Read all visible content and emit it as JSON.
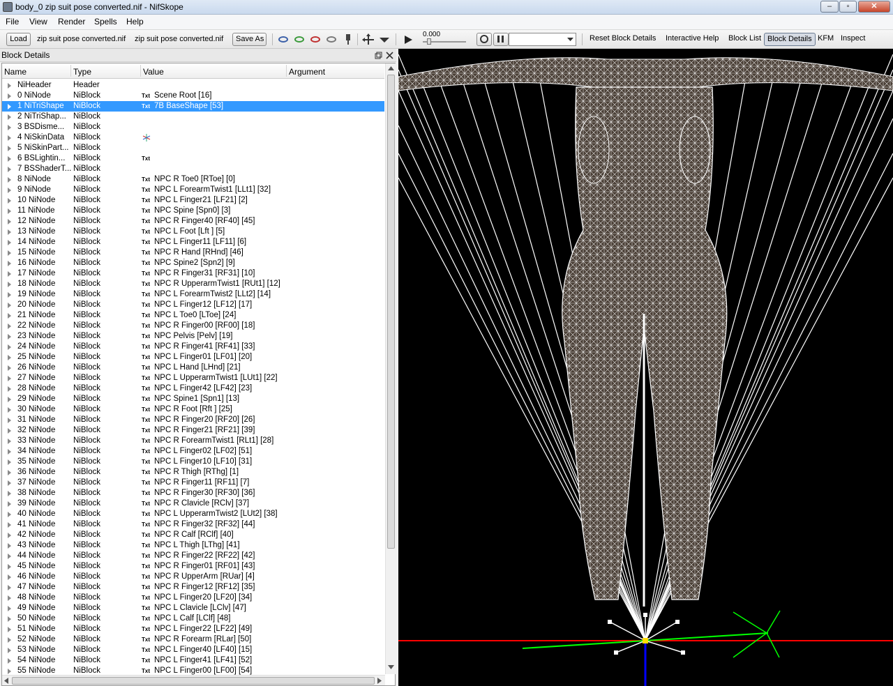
{
  "window": {
    "title": "body_0 zip suit pose converted.nif - NifSkope",
    "controls": [
      "‒",
      "▫",
      "✕"
    ]
  },
  "menu": [
    "File",
    "View",
    "Render",
    "Spells",
    "Help"
  ],
  "toolbar": {
    "load_label": "Load",
    "load_file": "zip suit pose converted.nif",
    "save_file": "zip suit pose converted.nif",
    "save_as_label": "Save As",
    "time_value": "0.000",
    "links": [
      "Reset Block Details",
      "Interactive Help",
      "Block List",
      "Block Details",
      "KFM",
      "Inspect"
    ],
    "active_link": "Block Details"
  },
  "dock": {
    "title": "Block Details",
    "columns": [
      "Name",
      "Type",
      "Value",
      "Argument"
    ]
  },
  "rows": [
    {
      "name": "NiHeader",
      "type": "Header",
      "txt": "",
      "value": ""
    },
    {
      "name": "0 NiNode",
      "type": "NiBlock",
      "txt": "Txt",
      "value": "Scene Root [16]"
    },
    {
      "name": "1 NiTriShape",
      "type": "NiBlock",
      "txt": "Txt",
      "value": "7B BaseShape [53]",
      "selected": true
    },
    {
      "name": "2 NiTriShap...",
      "type": "NiBlock",
      "txt": "",
      "value": ""
    },
    {
      "name": "3 BSDisme...",
      "type": "NiBlock",
      "txt": "",
      "value": ""
    },
    {
      "name": "4 NiSkinData",
      "type": "NiBlock",
      "txt": "",
      "value": "",
      "gizmo": true
    },
    {
      "name": "5 NiSkinPart...",
      "type": "NiBlock",
      "txt": "",
      "value": ""
    },
    {
      "name": "6 BSLightin...",
      "type": "NiBlock",
      "txt": "Txt",
      "value": ""
    },
    {
      "name": "7 BSShaderT...",
      "type": "NiBlock",
      "txt": "",
      "value": ""
    },
    {
      "name": "8 NiNode",
      "type": "NiBlock",
      "txt": "Txt",
      "value": "NPC R Toe0 [RToe] [0]"
    },
    {
      "name": "9 NiNode",
      "type": "NiBlock",
      "txt": "Txt",
      "value": "NPC L ForearmTwist1 [LLt1] [32]"
    },
    {
      "name": "10 NiNode",
      "type": "NiBlock",
      "txt": "Txt",
      "value": "NPC L Finger21 [LF21] [2]"
    },
    {
      "name": "11 NiNode",
      "type": "NiBlock",
      "txt": "Txt",
      "value": "NPC Spine [Spn0] [3]"
    },
    {
      "name": "12 NiNode",
      "type": "NiBlock",
      "txt": "Txt",
      "value": "NPC R Finger40 [RF40] [45]"
    },
    {
      "name": "13 NiNode",
      "type": "NiBlock",
      "txt": "Txt",
      "value": "NPC L Foot [Lft ] [5]"
    },
    {
      "name": "14 NiNode",
      "type": "NiBlock",
      "txt": "Txt",
      "value": "NPC L Finger11 [LF11] [6]"
    },
    {
      "name": "15 NiNode",
      "type": "NiBlock",
      "txt": "Txt",
      "value": "NPC R Hand [RHnd] [46]"
    },
    {
      "name": "16 NiNode",
      "type": "NiBlock",
      "txt": "Txt",
      "value": "NPC Spine2 [Spn2] [9]"
    },
    {
      "name": "17 NiNode",
      "type": "NiBlock",
      "txt": "Txt",
      "value": "NPC R Finger31 [RF31] [10]"
    },
    {
      "name": "18 NiNode",
      "type": "NiBlock",
      "txt": "Txt",
      "value": "NPC R UpperarmTwist1 [RUt1] [12]"
    },
    {
      "name": "19 NiNode",
      "type": "NiBlock",
      "txt": "Txt",
      "value": "NPC L ForearmTwist2 [LLt2] [14]"
    },
    {
      "name": "20 NiNode",
      "type": "NiBlock",
      "txt": "Txt",
      "value": "NPC L Finger12 [LF12] [17]"
    },
    {
      "name": "21 NiNode",
      "type": "NiBlock",
      "txt": "Txt",
      "value": "NPC L Toe0 [LToe] [24]"
    },
    {
      "name": "22 NiNode",
      "type": "NiBlock",
      "txt": "Txt",
      "value": "NPC R Finger00 [RF00] [18]"
    },
    {
      "name": "23 NiNode",
      "type": "NiBlock",
      "txt": "Txt",
      "value": "NPC Pelvis [Pelv] [19]"
    },
    {
      "name": "24 NiNode",
      "type": "NiBlock",
      "txt": "Txt",
      "value": "NPC R Finger41 [RF41] [33]"
    },
    {
      "name": "25 NiNode",
      "type": "NiBlock",
      "txt": "Txt",
      "value": "NPC L Finger01 [LF01] [20]"
    },
    {
      "name": "26 NiNode",
      "type": "NiBlock",
      "txt": "Txt",
      "value": "NPC L Hand [LHnd] [21]"
    },
    {
      "name": "27 NiNode",
      "type": "NiBlock",
      "txt": "Txt",
      "value": "NPC L UpperarmTwist1 [LUt1] [22]"
    },
    {
      "name": "28 NiNode",
      "type": "NiBlock",
      "txt": "Txt",
      "value": "NPC L Finger42 [LF42] [23]"
    },
    {
      "name": "29 NiNode",
      "type": "NiBlock",
      "txt": "Txt",
      "value": "NPC Spine1 [Spn1] [13]"
    },
    {
      "name": "30 NiNode",
      "type": "NiBlock",
      "txt": "Txt",
      "value": "NPC R Foot [Rft ] [25]"
    },
    {
      "name": "31 NiNode",
      "type": "NiBlock",
      "txt": "Txt",
      "value": "NPC R Finger20 [RF20] [26]"
    },
    {
      "name": "32 NiNode",
      "type": "NiBlock",
      "txt": "Txt",
      "value": "NPC R Finger21 [RF21] [39]"
    },
    {
      "name": "33 NiNode",
      "type": "NiBlock",
      "txt": "Txt",
      "value": "NPC R ForearmTwist1 [RLt1] [28]"
    },
    {
      "name": "34 NiNode",
      "type": "NiBlock",
      "txt": "Txt",
      "value": "NPC L Finger02 [LF02] [51]"
    },
    {
      "name": "35 NiNode",
      "type": "NiBlock",
      "txt": "Txt",
      "value": "NPC L Finger10 [LF10] [31]"
    },
    {
      "name": "36 NiNode",
      "type": "NiBlock",
      "txt": "Txt",
      "value": "NPC R Thigh [RThg] [1]"
    },
    {
      "name": "37 NiNode",
      "type": "NiBlock",
      "txt": "Txt",
      "value": "NPC R Finger11 [RF11] [7]"
    },
    {
      "name": "38 NiNode",
      "type": "NiBlock",
      "txt": "Txt",
      "value": "NPC R Finger30 [RF30] [36]"
    },
    {
      "name": "39 NiNode",
      "type": "NiBlock",
      "txt": "Txt",
      "value": "NPC R Clavicle [RClv] [37]"
    },
    {
      "name": "40 NiNode",
      "type": "NiBlock",
      "txt": "Txt",
      "value": "NPC L UpperarmTwist2 [LUt2] [38]"
    },
    {
      "name": "41 NiNode",
      "type": "NiBlock",
      "txt": "Txt",
      "value": "NPC R Finger32 [RF32] [44]"
    },
    {
      "name": "42 NiNode",
      "type": "NiBlock",
      "txt": "Txt",
      "value": "NPC R Calf [RClf] [40]"
    },
    {
      "name": "43 NiNode",
      "type": "NiBlock",
      "txt": "Txt",
      "value": "NPC L Thigh [LThg] [41]"
    },
    {
      "name": "44 NiNode",
      "type": "NiBlock",
      "txt": "Txt",
      "value": "NPC R Finger22 [RF22] [42]"
    },
    {
      "name": "45 NiNode",
      "type": "NiBlock",
      "txt": "Txt",
      "value": "NPC R Finger01 [RF01] [43]"
    },
    {
      "name": "46 NiNode",
      "type": "NiBlock",
      "txt": "Txt",
      "value": "NPC R UpperArm [RUar] [4]"
    },
    {
      "name": "47 NiNode",
      "type": "NiBlock",
      "txt": "Txt",
      "value": "NPC R Finger12 [RF12] [35]"
    },
    {
      "name": "48 NiNode",
      "type": "NiBlock",
      "txt": "Txt",
      "value": "NPC L Finger20 [LF20] [34]"
    },
    {
      "name": "49 NiNode",
      "type": "NiBlock",
      "txt": "Txt",
      "value": "NPC L Clavicle [LClv] [47]"
    },
    {
      "name": "50 NiNode",
      "type": "NiBlock",
      "txt": "Txt",
      "value": "NPC L Calf [LClf] [48]"
    },
    {
      "name": "51 NiNode",
      "type": "NiBlock",
      "txt": "Txt",
      "value": "NPC L Finger22 [LF22] [49]"
    },
    {
      "name": "52 NiNode",
      "type": "NiBlock",
      "txt": "Txt",
      "value": "NPC R Forearm [RLar] [50]"
    },
    {
      "name": "53 NiNode",
      "type": "NiBlock",
      "txt": "Txt",
      "value": "NPC L Finger40 [LF40] [15]"
    },
    {
      "name": "54 NiNode",
      "type": "NiBlock",
      "txt": "Txt",
      "value": "NPC L Finger41 [LF41] [52]"
    },
    {
      "name": "55 NiNode",
      "type": "NiBlock",
      "txt": "Txt",
      "value": "NPC L Finger00 [LF00] [54]"
    }
  ],
  "colors": {
    "selection": "#3399ff",
    "viewport_bg": "#000000",
    "wireframe": "#ffffff",
    "mesh_fill": "#4a3f36",
    "axis_x": "#ff0000",
    "axis_y": "#00ff00",
    "axis_z": "#0000ff"
  },
  "icons": [
    "nifskope-app-icon",
    "eye-blue-icon",
    "eye-green-icon",
    "eye-red-icon",
    "eye-grey-icon",
    "paint-icon",
    "move-icon",
    "play-icon",
    "loop-icon",
    "switch-icon",
    "dropdown-icon",
    "float-icon",
    "close-icon"
  ]
}
